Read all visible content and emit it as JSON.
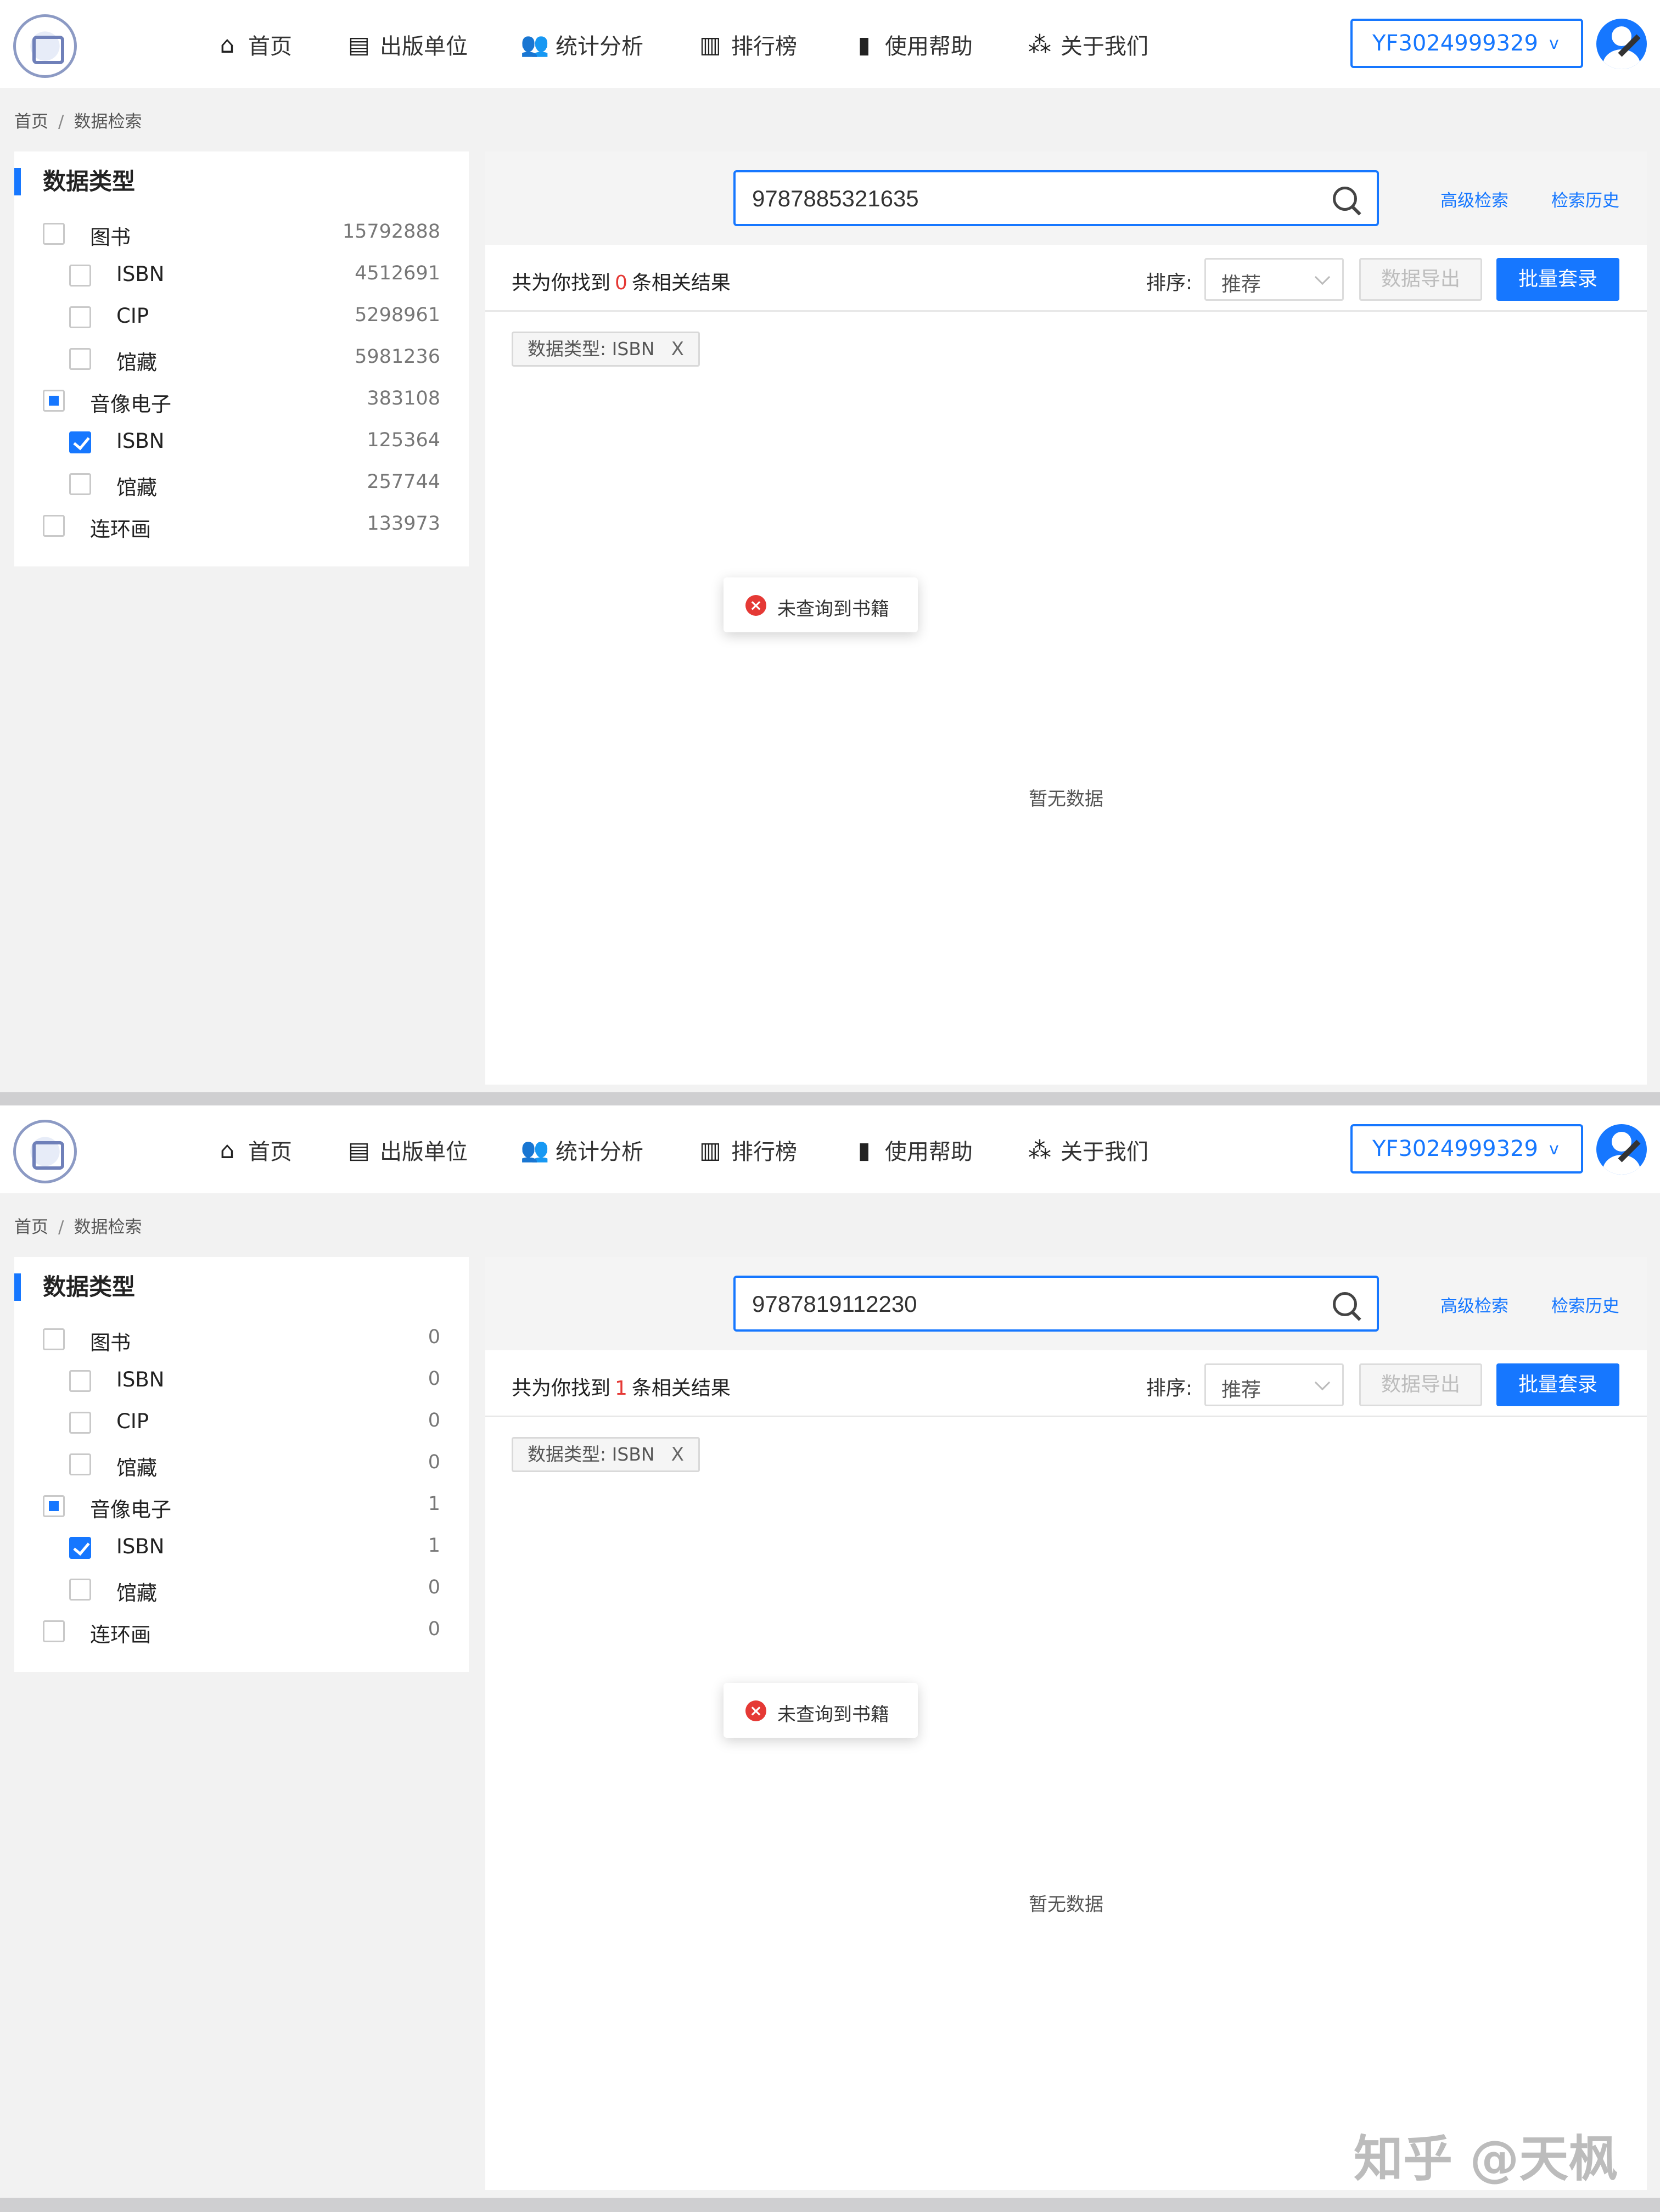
{
  "nav": {
    "items": [
      {
        "label": "首页",
        "icon": "⌂"
      },
      {
        "label": "出版单位",
        "icon": "▤"
      },
      {
        "label": "统计分析",
        "icon": "👥"
      },
      {
        "label": "排行榜",
        "icon": "▥"
      },
      {
        "label": "使用帮助",
        "icon": "▮"
      },
      {
        "label": "关于我们",
        "icon": "⁂"
      }
    ],
    "user": "YF3024999329",
    "user_chevron": "v"
  },
  "breadcrumb": [
    "首页",
    "数据检索"
  ],
  "breadcrumb_sep": "/",
  "sidebar_title": "数据类型",
  "main_labels": {
    "advanced_search": "高级检索",
    "search_history": "检索历史",
    "result_prefix": "共为你找到",
    "result_suffix": "条相关结果",
    "sort_label": "排序:",
    "sort_value": "推荐",
    "export_button": "数据导出",
    "batch_button": "批量套录",
    "filter_tag": "数据类型: ISBN",
    "filter_close": "X",
    "toast": "未查询到书籍",
    "toast_icon": "×",
    "empty": "暂无数据"
  },
  "screens": [
    {
      "search_value": "9787885321635",
      "result_count": "0",
      "tree": [
        {
          "label": "图书",
          "count": "15792888"
        },
        {
          "label": "ISBN",
          "count": "4512691"
        },
        {
          "label": "CIP",
          "count": "5298961"
        },
        {
          "label": "馆藏",
          "count": "5981236"
        },
        {
          "label": "音像电子",
          "count": "383108"
        },
        {
          "label": "ISBN",
          "count": "125364"
        },
        {
          "label": "馆藏",
          "count": "257744"
        },
        {
          "label": "连环画",
          "count": "133973"
        }
      ]
    },
    {
      "search_value": "9787819112230",
      "result_count": "1",
      "tree": [
        {
          "label": "图书",
          "count": "0"
        },
        {
          "label": "ISBN",
          "count": "0"
        },
        {
          "label": "CIP",
          "count": "0"
        },
        {
          "label": "馆藏",
          "count": "0"
        },
        {
          "label": "音像电子",
          "count": "1"
        },
        {
          "label": "ISBN",
          "count": "1"
        },
        {
          "label": "馆藏",
          "count": "0"
        },
        {
          "label": "连环画",
          "count": "0"
        }
      ]
    }
  ],
  "watermark": "知乎 @天枫",
  "colors": {
    "accent": "#1677ff",
    "error": "#e53935"
  }
}
